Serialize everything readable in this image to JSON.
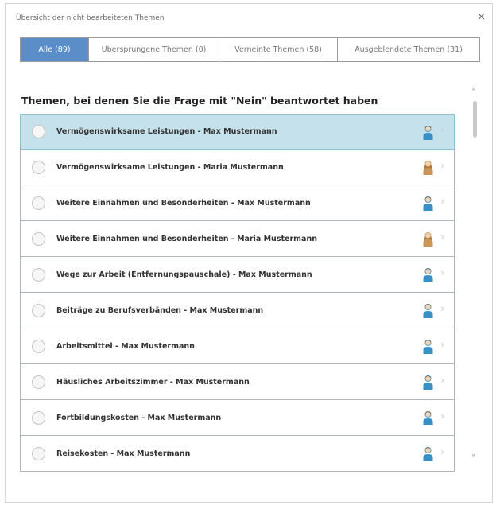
{
  "dialog": {
    "title": "Übersicht der nicht bearbeiteten Themen",
    "close_glyph": "×"
  },
  "tabs": [
    {
      "label": "Alle (89)",
      "active": true
    },
    {
      "label": "Übersprungene Themen (0)",
      "active": false
    },
    {
      "label": "Verneinte Themen (58)",
      "active": false
    },
    {
      "label": "Ausgeblendete Themen (31)",
      "active": false
    }
  ],
  "section": {
    "heading": "Themen, bei denen Sie die Frage mit \"Nein\" beantwortet haben"
  },
  "items": [
    {
      "label": "Vermögenswirksame Leistungen - Max Mustermann",
      "person": "male",
      "selected": true
    },
    {
      "label": "Vermögenswirksame Leistungen - Maria Mustermann",
      "person": "female",
      "selected": false
    },
    {
      "label": "Weitere Einnahmen und Besonderheiten - Max Mustermann",
      "person": "male",
      "selected": false
    },
    {
      "label": "Weitere Einnahmen und Besonderheiten - Maria Mustermann",
      "person": "female",
      "selected": false
    },
    {
      "label": "Wege zur Arbeit (Entfernungspauschale) - Max Mustermann",
      "person": "male",
      "selected": false
    },
    {
      "label": "Beiträge zu Berufsverbänden - Max Mustermann",
      "person": "male",
      "selected": false
    },
    {
      "label": "Arbeitsmittel - Max Mustermann",
      "person": "male",
      "selected": false
    },
    {
      "label": "Häusliches Arbeitszimmer - Max Mustermann",
      "person": "male",
      "selected": false
    },
    {
      "label": "Fortbildungskosten - Max Mustermann",
      "person": "male",
      "selected": false
    },
    {
      "label": "Reisekosten - Max Mustermann",
      "person": "male",
      "selected": false
    }
  ],
  "icons": {
    "chevron": "›",
    "scroll_up": "˄",
    "scroll_down": "˅"
  },
  "colors": {
    "accent": "#5b8ec8",
    "selected_row": "#c5e2ec",
    "male_icon": "#3a8fc4",
    "female_icon": "#c8955a"
  }
}
